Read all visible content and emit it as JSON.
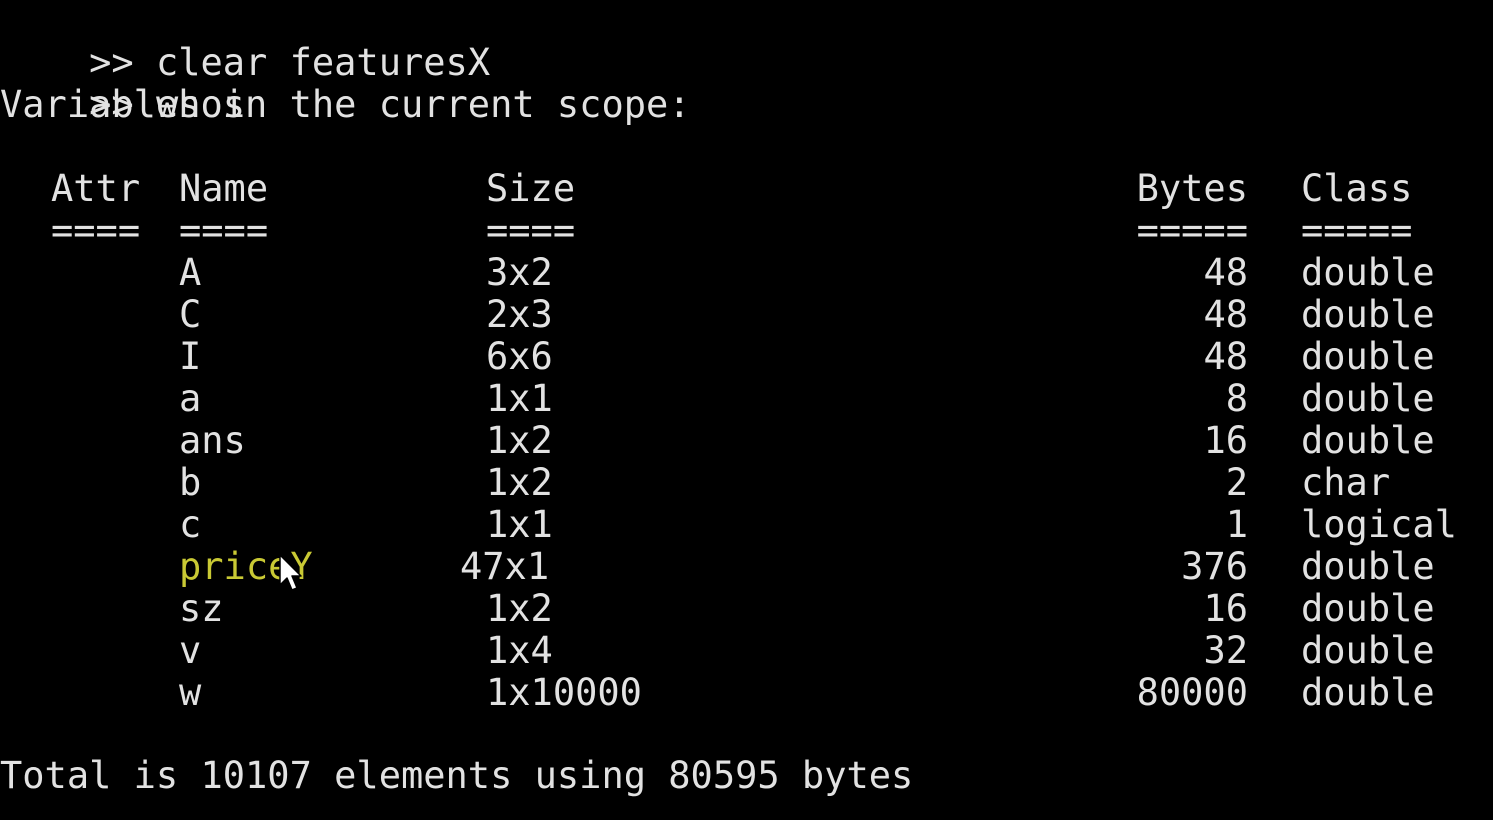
{
  "commands": [
    {
      "prompt": ">>",
      "text": "clear featuresX"
    },
    {
      "prompt": ">>",
      "text": "whos"
    }
  ],
  "scope_heading": "Variables in the current scope:",
  "table": {
    "headers": {
      "attr": "Attr",
      "name": "Name",
      "size": "Size",
      "bytes": "Bytes",
      "class": "Class"
    },
    "separators": {
      "attr": "====",
      "name": "====",
      "size": "====",
      "bytes": "=====",
      "class": "====="
    },
    "rows": [
      {
        "attr": "",
        "name": "A",
        "size": "3x2",
        "bytes": "48",
        "class": "double"
      },
      {
        "attr": "",
        "name": "C",
        "size": "2x3",
        "bytes": "48",
        "class": "double"
      },
      {
        "attr": "",
        "name": "I",
        "size": "6x6",
        "bytes": "48",
        "class": "double"
      },
      {
        "attr": "",
        "name": "a",
        "size": "1x1",
        "bytes": "8",
        "class": "double"
      },
      {
        "attr": "",
        "name": "ans",
        "size": "1x2",
        "bytes": "16",
        "class": "double"
      },
      {
        "attr": "",
        "name": "b",
        "size": "1x2",
        "bytes": "2",
        "class": "char"
      },
      {
        "attr": "",
        "name": "c",
        "size": "1x1",
        "bytes": "1",
        "class": "logical"
      },
      {
        "attr": "",
        "name": "priceY",
        "size": "47x1",
        "bytes": "376",
        "class": "double"
      },
      {
        "attr": "",
        "name": "sz",
        "size": "1x2",
        "bytes": "16",
        "class": "double"
      },
      {
        "attr": "",
        "name": "v",
        "size": "1x4",
        "bytes": "32",
        "class": "double"
      },
      {
        "attr": "",
        "name": "w",
        "size": "1x10000",
        "bytes": "80000",
        "class": "double"
      }
    ]
  },
  "total_line": "Total is 10107 elements using 80595 bytes",
  "highlighted_row": "priceY",
  "colors": {
    "background": "#000000",
    "text": "#e2e2e2",
    "highlight": "#c9c934"
  },
  "cursor_icon": "mouse-pointer-icon"
}
